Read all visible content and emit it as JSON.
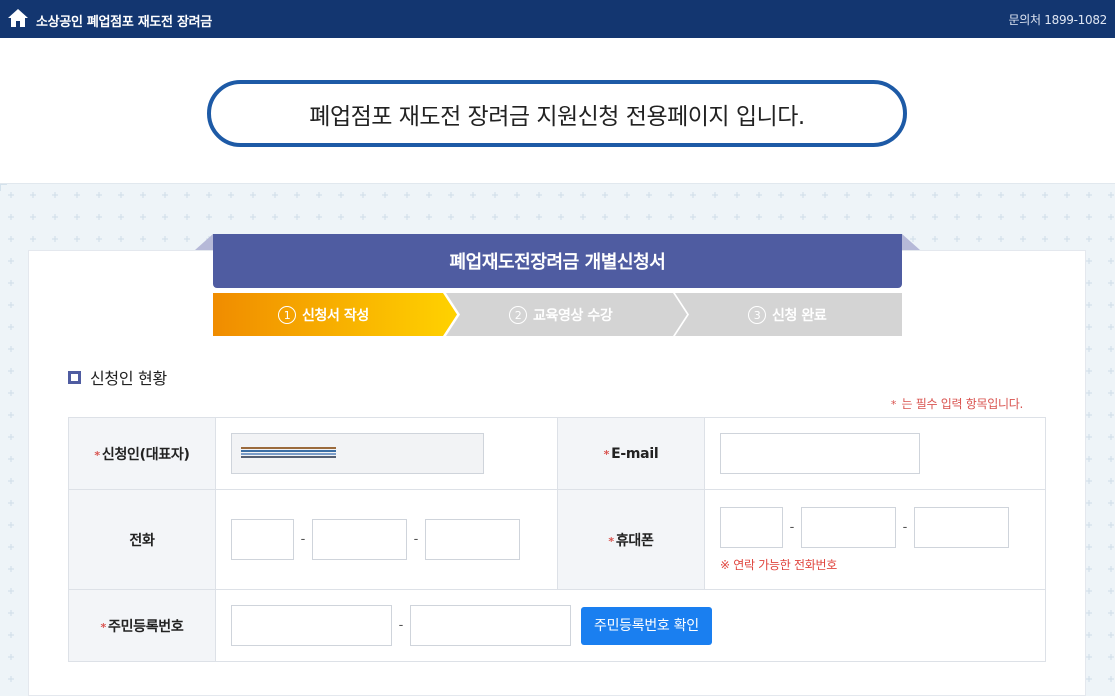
{
  "topbar": {
    "title": "소상공인 폐업점포 재도전 장려금",
    "phone": "문의처 1899-1082"
  },
  "banner": {
    "text": "폐업점포 재도전 장려금 지원신청 전용페이지 입니다."
  },
  "form": {
    "header": "폐업재도전장려금 개별신청서",
    "steps": [
      {
        "num": "1",
        "label": "신청서 작성",
        "active": true
      },
      {
        "num": "2",
        "label": "교육영상 수강",
        "active": false
      },
      {
        "num": "3",
        "label": "신청 완료",
        "active": false
      }
    ]
  },
  "section": {
    "title": "신청인 현황",
    "required_star": "*",
    "required_note": "는 필수 입력 항목입니다."
  },
  "fields": {
    "applicant_label": "신청인(대표자)",
    "email_label": "E-mail",
    "phone_label": "전화",
    "mobile_label": "휴대폰",
    "mobile_hint": "※ 연락 가능한 전화번호",
    "rrn_label": "주민등록번호",
    "rrn_button": "주민등록번호 확인",
    "dash": "-"
  },
  "colors": {
    "topbar": "#133670",
    "banner_border": "#1d5aa6",
    "header": "#4f5ca1",
    "step_active_start": "#f08c00",
    "step_active_end": "#ffd200",
    "step_inactive": "#d3d3d3",
    "required": "#d9534f",
    "button": "#1a7ff0"
  },
  "icons": {
    "home": "home-icon"
  }
}
